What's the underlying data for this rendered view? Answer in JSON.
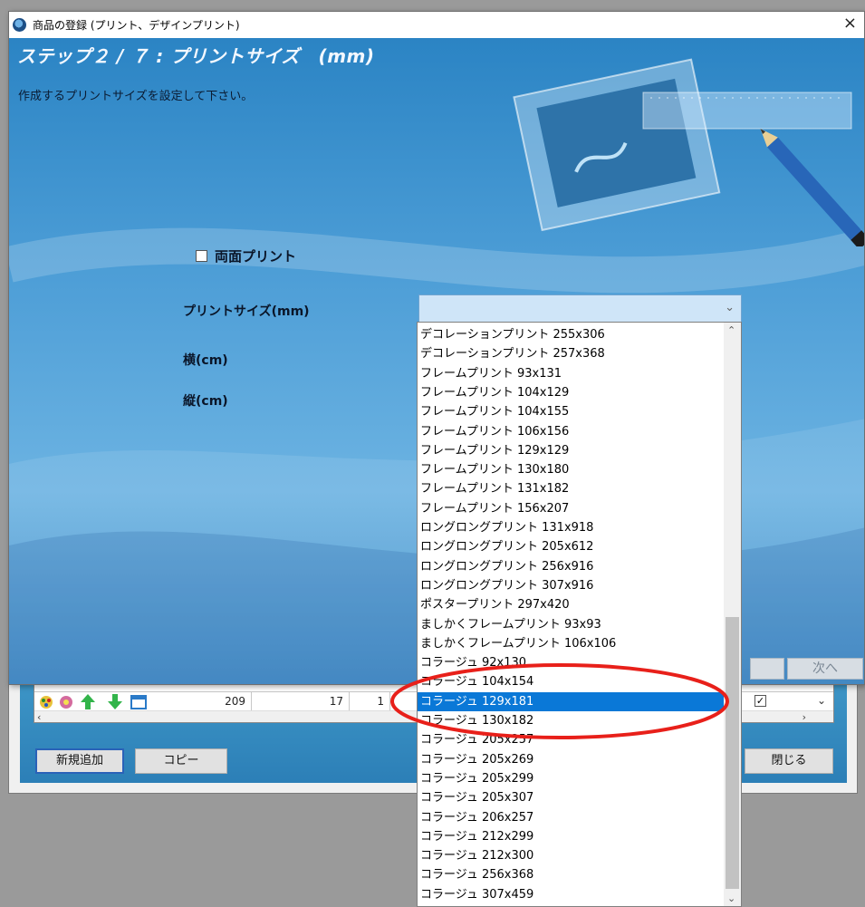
{
  "dialog": {
    "title": "商品の登録 (プリント、デザインプリント)",
    "close_glyph": "×",
    "step_title": "ステップ２ / ７ : プリントサイズ　(mm)",
    "subtitle": "作成するプリントサイズを設定して下さい。",
    "duplex_label": "両面プリント",
    "print_size_label": "プリントサイズ(mm)",
    "width_label": "横(cm)",
    "height_label": "縦(cm)",
    "combo_value": "",
    "next_label": "次へ"
  },
  "dropdown": {
    "selected_index": 19,
    "options": [
      "デコレーションプリント 255x306",
      "デコレーションプリント 257x368",
      "フレームプリント 93x131",
      "フレームプリント 104x129",
      "フレームプリント 104x155",
      "フレームプリント 106x156",
      "フレームプリント 129x129",
      "フレームプリント 130x180",
      "フレームプリント 131x182",
      "フレームプリント 156x207",
      "ロングロングプリント 131x918",
      "ロングロングプリント 205x612",
      "ロングロングプリント 256x916",
      "ロングロングプリント 307x916",
      "ポスタープリント 297x420",
      "ましかくフレームプリント 93x93",
      "ましかくフレームプリント 106x106",
      "コラージュ 92x130",
      "コラージュ 104x154",
      "コラージュ 129x181",
      "コラージュ 130x182",
      "コラージュ 205x257",
      "コラージュ 205x269",
      "コラージュ 205x299",
      "コラージュ 205x307",
      "コラージュ 206x257",
      "コラージュ 212x299",
      "コラージュ 212x300",
      "コラージュ 256x368",
      "コラージュ 307x459"
    ]
  },
  "background_window": {
    "row": {
      "col1": "209",
      "col2": "17",
      "col3": "1"
    },
    "new_button": "新規追加",
    "copy_button": "コピー",
    "close_button": "閉じる"
  },
  "colors": {
    "selection": "#0a78d7",
    "annotation": "#e8201a"
  }
}
